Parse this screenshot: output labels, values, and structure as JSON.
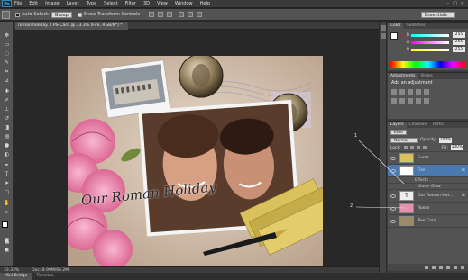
{
  "menu": {
    "logo": "Ps",
    "items": [
      "File",
      "Edit",
      "Image",
      "Layer",
      "Type",
      "Select",
      "Filter",
      "3D",
      "View",
      "Window",
      "Help"
    ],
    "window_controls": [
      "–",
      "□",
      "×"
    ]
  },
  "options_bar": {
    "auto_select_label": "Auto-Select:",
    "auto_select_value": "Group",
    "show_transform_label": "Show Transform Controls",
    "workspace_value": "Essentials"
  },
  "document": {
    "tab_title": "roman holiday 2.PS-Card @ 33.3% (Fire, RGB/8*) *",
    "caption": "Our Roman Holiday"
  },
  "status": {
    "zoom": "33.33%",
    "doc_size": "Doc: 8.99M/66.2M"
  },
  "bottom_tabs": [
    "Mini Bridge",
    "Timeline"
  ],
  "color_panel": {
    "tabs": [
      "Color",
      "Swatches"
    ],
    "sliders": [
      {
        "label": "R",
        "value": "255",
        "color": "#e05050"
      },
      {
        "label": "G",
        "value": "255",
        "color": "#50b050"
      },
      {
        "label": "B",
        "value": "255",
        "color": "#5070e0"
      }
    ]
  },
  "adjustments_panel": {
    "tabs": [
      "Adjustments",
      "Styles"
    ],
    "title": "Add an adjustment"
  },
  "layers_panel": {
    "tabs": [
      "Layers",
      "Channels",
      "Paths"
    ],
    "kind_label": "Kind",
    "blend_mode": "Normal",
    "opacity_label": "Opacity:",
    "opacity_value": "100%",
    "lock_label": "Lock:",
    "fill_label": "Fill:",
    "fill_value": "100%",
    "layers": [
      {
        "name": "Euros",
        "active": false,
        "fx": false
      },
      {
        "name": "Fire",
        "active": true,
        "fx": true
      },
      {
        "name": "Our Roman Hol...",
        "active": false,
        "fx": true
      },
      {
        "name": "Roses",
        "active": false,
        "fx": false
      },
      {
        "name": "Two Coin",
        "active": false,
        "fx": false
      }
    ],
    "effects_label": "Effects",
    "outer_glow_label": "Outer Glow"
  },
  "callouts": [
    "1",
    "2"
  ],
  "colors": {
    "accent": "#4a79b0",
    "panel_bg": "#535353",
    "canvas_bg": "#282828"
  }
}
